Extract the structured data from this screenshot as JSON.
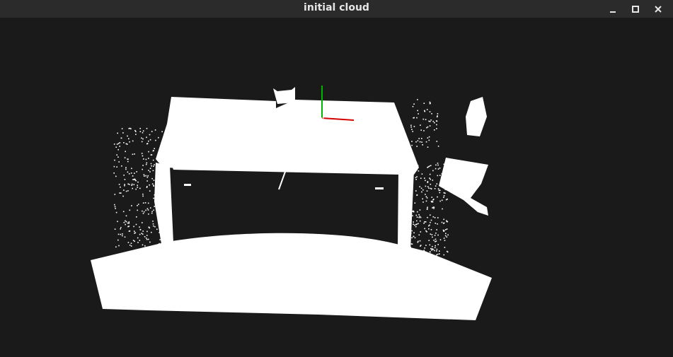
{
  "window": {
    "title": "initial cloud",
    "controls": {
      "minimize_icon": "minimize-icon",
      "maximize_icon": "maximize-icon",
      "close_icon": "close-icon"
    }
  },
  "viewport": {
    "background": "#1a1a1a",
    "point_color": "#ffffff",
    "axes": {
      "x_color": "#d40000",
      "y_color": "#00b400"
    }
  }
}
